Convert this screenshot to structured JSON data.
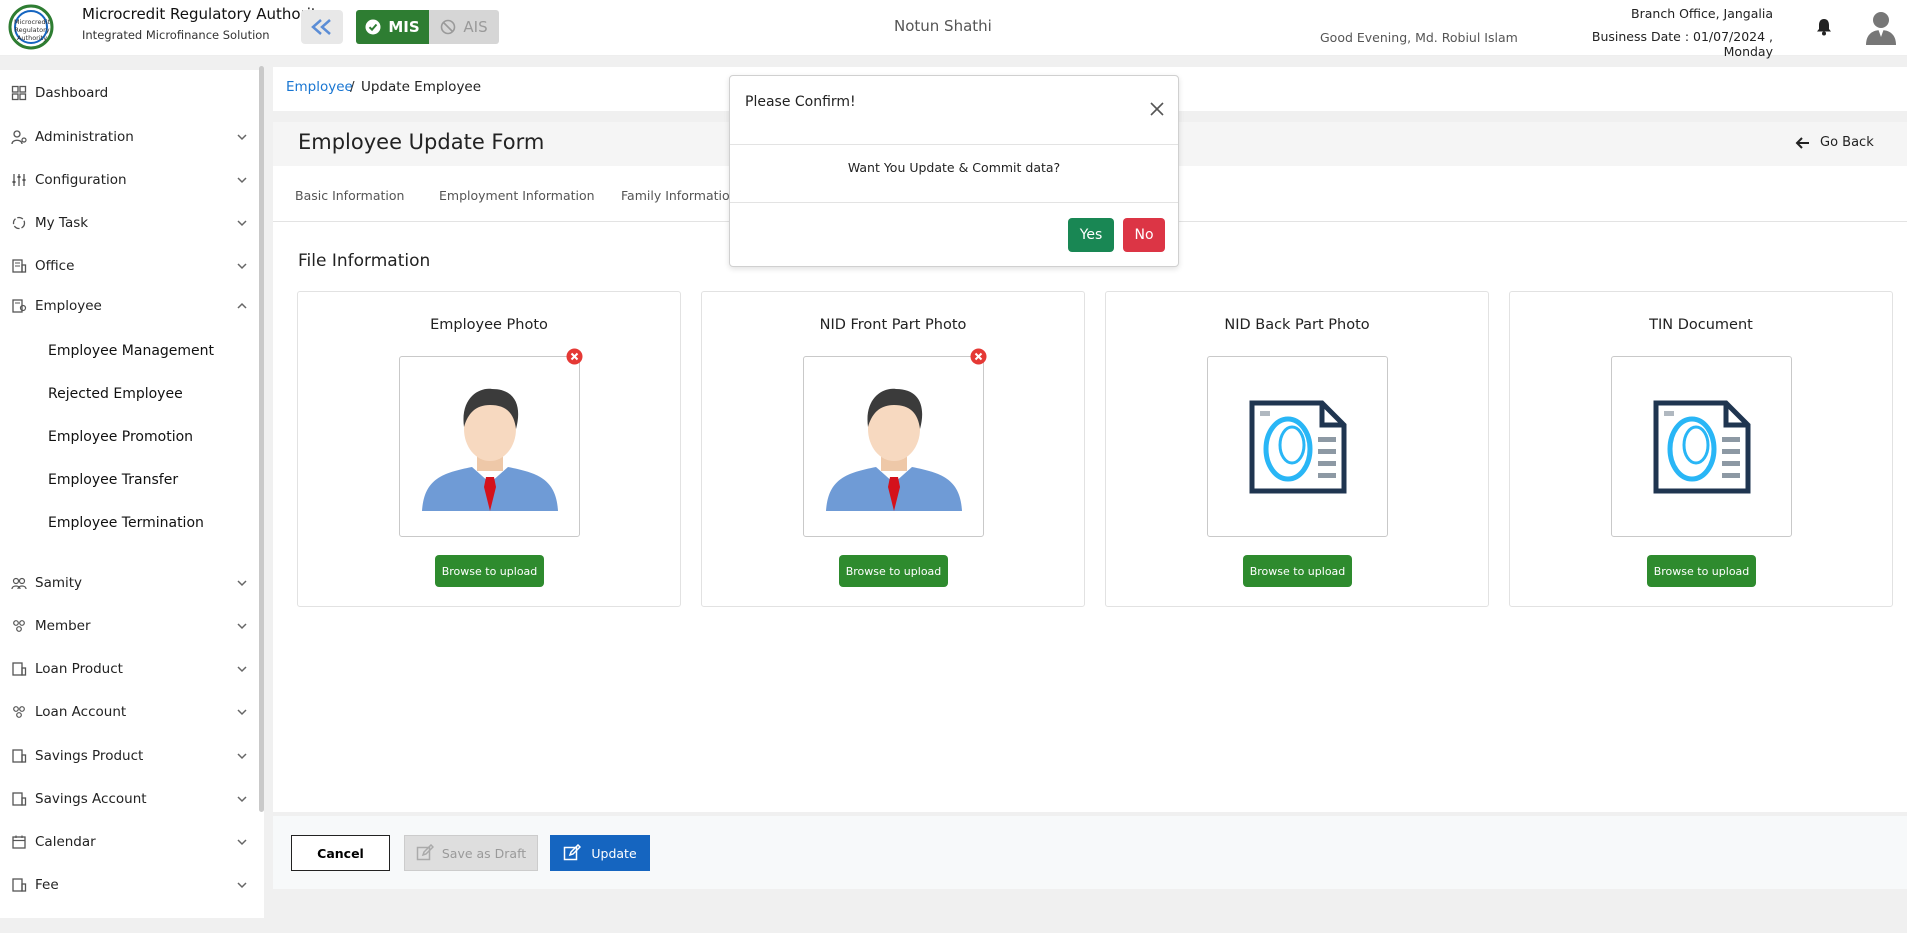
{
  "header": {
    "brand_title": "Microcredit Regulatory Authority",
    "brand_subtitle": "Integrated Microfinance Solution",
    "logo_text": [
      "Microcredit",
      "Regulatory",
      "Authority"
    ],
    "mis_label": "MIS",
    "ais_label": "AIS",
    "center_name": "Notun Shathi",
    "greeting": "Good Evening, Md. Robiul Islam",
    "branch": "Branch Office, Jangalia",
    "business_date": "Business Date : 01/07/2024 , Monday",
    "icons": [
      "double-chevron-left-icon",
      "check-circle-icon",
      "ban-icon",
      "bell-icon",
      "user-avatar-icon"
    ]
  },
  "sidebar": {
    "items": [
      {
        "label": "Dashboard",
        "icon": "dashboard-icon",
        "expandable": false
      },
      {
        "label": "Administration",
        "icon": "admin-icon",
        "expandable": true
      },
      {
        "label": "Configuration",
        "icon": "sliders-icon",
        "expandable": true
      },
      {
        "label": "My Task",
        "icon": "task-icon",
        "expandable": true
      },
      {
        "label": "Office",
        "icon": "office-icon",
        "expandable": true
      },
      {
        "label": "Employee",
        "icon": "employee-icon",
        "expandable": true,
        "expanded": true
      },
      {
        "label": "Samity",
        "icon": "samity-icon",
        "expandable": true
      },
      {
        "label": "Member",
        "icon": "member-icon",
        "expandable": true
      },
      {
        "label": "Loan Product",
        "icon": "loan-product-icon",
        "expandable": true
      },
      {
        "label": "Loan Account",
        "icon": "loan-account-icon",
        "expandable": true
      },
      {
        "label": "Savings Product",
        "icon": "savings-product-icon",
        "expandable": true
      },
      {
        "label": "Savings Account",
        "icon": "savings-account-icon",
        "expandable": true
      },
      {
        "label": "Calendar",
        "icon": "calendar-icon",
        "expandable": true
      },
      {
        "label": "Fee",
        "icon": "fee-icon",
        "expandable": true
      }
    ],
    "employee_sub": [
      "Employee Management",
      "Rejected Employee",
      "Employee Promotion",
      "Employee Transfer",
      "Employee Termination"
    ]
  },
  "breadcrumb": {
    "parent": "Employee",
    "separator": "/",
    "current": "Update Employee"
  },
  "form": {
    "title": "Employee Update Form",
    "go_back": "Go Back",
    "tabs": [
      "Basic Information",
      "Employment Information",
      "Family Information"
    ],
    "section_title": "File Information",
    "cards": [
      {
        "title": "Employee Photo",
        "image": "person-photo",
        "removable": true,
        "button": "Browse to upload"
      },
      {
        "title": "NID Front Part Photo",
        "image": "person-photo",
        "removable": true,
        "button": "Browse to upload"
      },
      {
        "title": "NID Back Part Photo",
        "image": "document-placeholder",
        "removable": false,
        "button": "Browse to upload"
      },
      {
        "title": "TIN Document",
        "image": "document-placeholder",
        "removable": false,
        "button": "Browse to upload"
      }
    ]
  },
  "footer": {
    "cancel": "Cancel",
    "save_draft": "Save as Draft",
    "update": "Update"
  },
  "modal": {
    "title": "Please Confirm!",
    "message": "Want You Update & Commit data?",
    "yes": "Yes",
    "no": "No"
  },
  "colors": {
    "primary": "#1565c0",
    "success": "#2e8b2e",
    "mis_green": "#2e7d32",
    "danger": "#dc3545",
    "link": "#1976d2"
  }
}
